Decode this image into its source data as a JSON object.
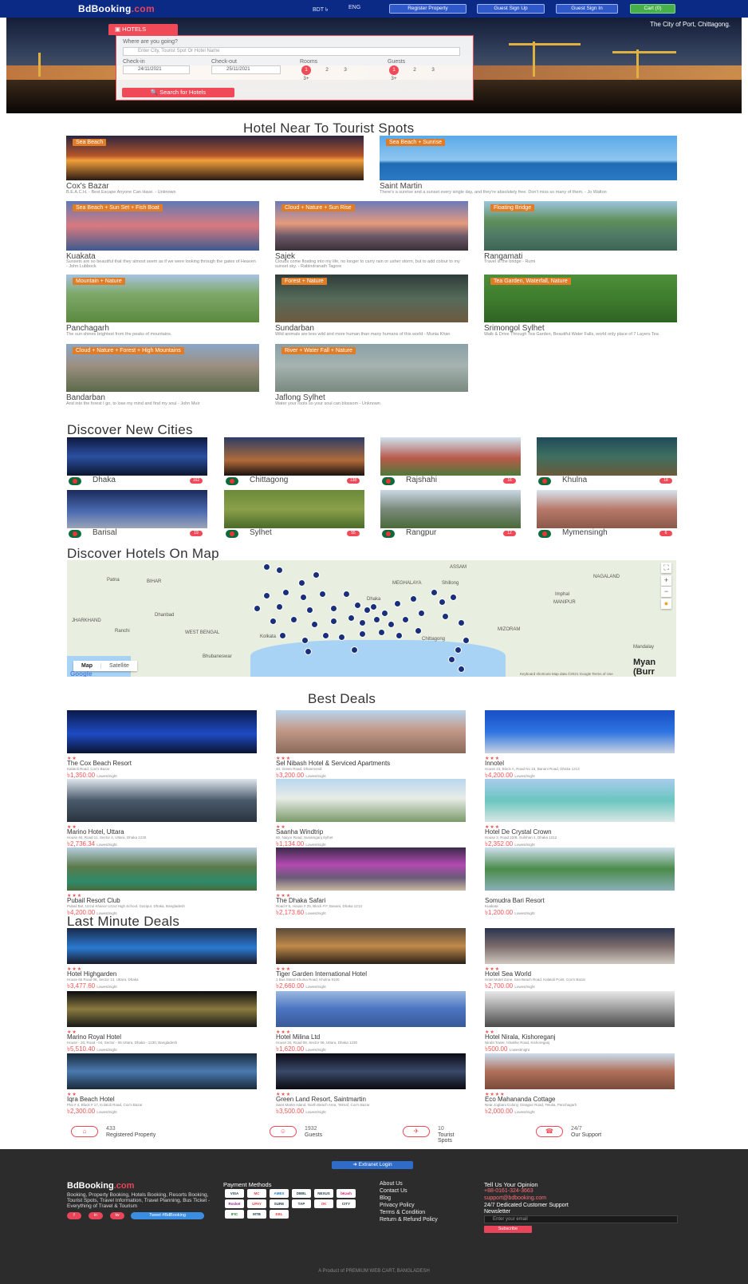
{
  "nav": {
    "brand": "BdBooking",
    "brand_suffix": ".com",
    "currency": "BDT ৳",
    "language": "ENG",
    "register_property": "Register Property",
    "guest_signup": "Guest Sign Up",
    "guest_signin": "Guest Sign In",
    "cart": "Cart (0)"
  },
  "hero": {
    "caption": "The City of Port, Chittagong.",
    "tab": "HOTELS",
    "where_label": "Where are you going?",
    "where_placeholder": "Enter City, Tourist Spot Or Hotel Name",
    "checkin_label": "Check-in",
    "checkin_value": "24/11/2021",
    "checkout_label": "Check-out",
    "checkout_value": "25/11/2021",
    "rooms_label": "Rooms",
    "guests_label": "Guests",
    "options": [
      "1",
      "2",
      "3"
    ],
    "more": "3+",
    "search_button": "Search for Hotels"
  },
  "spots": {
    "title": "Hotel Near To Tourist Spots",
    "items": [
      {
        "tag": "Sea Beach",
        "name": "Cox's Bazar",
        "quote": "B.E.A.C.H. - Best Escape Anyone Can Have. - Unknown"
      },
      {
        "tag": "Sea Beach + Sunrise",
        "name": "Saint Martin",
        "quote": "There's a sunrise and a sunset every single day, and they're absolutely free. Don't miss so many of them. - Jo Walton"
      },
      {
        "tag": "Sea Beach + Sun Set + Fish Boat",
        "name": "Kuakata",
        "quote": "Sunsets are so beautiful that they almost seem as if we were looking through the gates of Heaven - John Lubbock"
      },
      {
        "tag": "Cloud + Nature + Sun Rise",
        "name": "Sajek",
        "quote": "Clouds come floating into my life, no longer to carry rain or usher storm, but to add colour to my sunset sky. - Rabindranath Tagore"
      },
      {
        "tag": "Floating Bridge",
        "name": "Rangamati",
        "quote": "Travel is the bridge - Rumi"
      },
      {
        "tag": "Mountain + Nature",
        "name": "Panchagarh",
        "quote": "The sun shines brightest from the peaks of mountains."
      },
      {
        "tag": "Forest + Nature",
        "name": "Sundarban",
        "quote": "Wild animals are less wild and more human than many humans of this world - Munia Khan"
      },
      {
        "tag": "Tea Garden, Waterfall, Nature",
        "name": "Srimongol Sylhet",
        "quote": "Walk & Drive Through Tea Garden, Beautiful Water Falls, world only place of 7 Layers Tea"
      },
      {
        "tag": "Cloud + Nature + Forest + High Mountains",
        "name": "Bandarban",
        "quote": "And into the forest I go, to lose my mind and find my soul - John Muir"
      },
      {
        "tag": "River + Water Fall + Nature",
        "name": "Jaflong Sylhet",
        "quote": "Water your roots so your soul can blossom - Unknown"
      }
    ]
  },
  "cities": {
    "title": "Discover New Cities",
    "items": [
      {
        "name": "Dhaka",
        "count": "162"
      },
      {
        "name": "Chittagong",
        "count": "138"
      },
      {
        "name": "Rajshahi",
        "count": "16"
      },
      {
        "name": "Khulna",
        "count": "18"
      },
      {
        "name": "Barisal",
        "count": "19"
      },
      {
        "name": "Sylhet",
        "count": "55"
      },
      {
        "name": "Rangpur",
        "count": "12"
      },
      {
        "name": "Mymensingh",
        "count": "6"
      }
    ]
  },
  "map": {
    "title": "Discover Hotels On Map",
    "map_btn": "Map",
    "satellite_btn": "Satellite",
    "google": "Google",
    "attribution": "Keyboard shortcuts   Map data ©2021 Google   Terms of Use",
    "labels": [
      "Patna",
      "BIHAR",
      "JHARKHAND",
      "WEST BENGAL",
      "Kolkata",
      "MEGHALAYA",
      "NAGALAND",
      "MANIPUR",
      "MIZORAM",
      "Mandalay",
      "Myan (Burr",
      "Ranchi",
      "Dhanbad",
      "Bhubaneswar",
      "Dhaka",
      "Chittagong",
      "ASSAM",
      "Shillong",
      "Imphal"
    ]
  },
  "best": {
    "title": "Best Deals",
    "items": [
      {
        "stars": "★★",
        "name": "The Cox Beach Resort",
        "address": "Kalatoli Road, Cox's Bazar",
        "price": "৳1,350.00"
      },
      {
        "stars": "★★★",
        "name": "Sel Nibash Hotel & Serviced Apartments",
        "address": "40, Green Road, Dhanmondi",
        "price": "৳3,200.00"
      },
      {
        "stars": "★★★",
        "name": "Innotel",
        "address": "House 23, Block A, Road No 15, Banani Road, Dhaka 1213",
        "price": "৳4,200.00"
      },
      {
        "stars": "★★",
        "name": "Marino Hotel, Uttara",
        "address": "House 40, Road 11, Sector 4, Uttara, Dhaka 1230",
        "price": "৳2,736.34"
      },
      {
        "stars": "★★",
        "name": "Saanha Windtrip",
        "address": "60, Naiyor Road, Sunamganj Sylhet",
        "price": "৳1,134.00"
      },
      {
        "stars": "★★★",
        "name": "Hotel De Crystal Crown",
        "address": "House 3, Road 22/B, Gulshan 1, Dhaka 1212",
        "price": "৳2,352.00"
      },
      {
        "stars": "★★★",
        "name": "Pubail Resort Club",
        "address": "Pubail Bot, Uzzul Khanor Uzzul High School, Gazipur, Dhaka, Bangladesh",
        "price": "৳4,200.00"
      },
      {
        "stars": "★★★",
        "name": "The Dhaka Safari",
        "address": "Road # 6, House # 25, Block # F, Banani, Dhaka 1213",
        "price": "৳2,173.60"
      },
      {
        "stars": "",
        "name": "Somudra Bari Resort",
        "address": "Kuakata",
        "price": "৳1,200.00"
      }
    ]
  },
  "last": {
    "title": "Last Minute Deals",
    "items": [
      {
        "stars": "★★★",
        "name": "Hotel Highgarden",
        "address": "House 65 Road 08, Sector 13, Uttara, Dhaka",
        "price": "৳3,477.60"
      },
      {
        "stars": "★★★",
        "name": "Tiger Garden International Hotel",
        "address": "1 Bus Stand Khulna Road, Khulna 9100",
        "price": "৳2,660.00"
      },
      {
        "stars": "★★★",
        "name": "Hotel Sea World",
        "address": "Hotel Motel Zone, Sea Beach Road, Kalatoli Point, Cox's Bazar",
        "price": "৳2,700.00"
      },
      {
        "stars": "★★",
        "name": "Marino Royal Hotel",
        "address": "House - 20, Road - 04, Sector - 06 Uttara, Dhaka - 1230, Bangladesh",
        "price": "৳5,510.40"
      },
      {
        "stars": "★★★",
        "name": "Hotel Milina Ltd",
        "address": "House 34, Road 08, Sector 06, Uttara, Dhaka 1230",
        "price": "৳1,620.00"
      },
      {
        "stars": "★★",
        "name": "Hotel Nirala, Kishoreganj",
        "address": "Nirala Tower, Ishakhe Road, Kishoreganj",
        "price": "৳500.00"
      },
      {
        "stars": "★★",
        "name": "Iqra Beach Hotel",
        "address": "Plot # 4, Block # 17, Kolatoli Road, Cox's Bazar",
        "price": "৳2,300.00"
      },
      {
        "stars": "★★★",
        "name": "Green Land Resort, Saintmartin",
        "address": "Saint Martin Island, North Beach Area, Teknaf, Cox's Bazar",
        "price": "৳3,500.00"
      },
      {
        "stars": "★★★★",
        "name": "Eco Mahananda Cottage",
        "address": "Near Jogbani Colony, Dinajpur Road, Tetulia, Panchagarh",
        "price": "৳2,000.00"
      }
    ]
  },
  "per_night": "Lowest/night",
  "stats": [
    {
      "icon": "home-icon",
      "number": "433",
      "label": "Registered Property"
    },
    {
      "icon": "users-icon",
      "number": "1932",
      "label": "Guests"
    },
    {
      "icon": "plane-icon",
      "number": "10",
      "label": "Tourist Spots"
    },
    {
      "icon": "phone-icon",
      "number": "24/7",
      "label": "Our Support"
    }
  ],
  "footer": {
    "extranet": "Extranet Login",
    "brand": "BdBooking",
    "brand_suffix": ".com",
    "desc": "Booking, Property Booking, Hotels Booking, Resorts Booking, Tourist Spots, Travel Information, Travel Planning, Bus Ticket - Everything of Travel & Tourism",
    "social": [
      "f",
      "in",
      "tw"
    ],
    "tweet": "Tweet #BdBooking",
    "payment_title": "Payment Methods",
    "payments": [
      "VISA",
      "MC",
      "AMEX",
      "DBBL",
      "NEXUS",
      "bKash",
      "Rocket",
      "UPAY",
      "SURE",
      "TAP",
      "OK",
      "CITY",
      "IFIC",
      "MTB",
      "EBL"
    ],
    "links": [
      "About Us",
      "Contact Us",
      "Blog",
      "Privacy Policy",
      "Terms & Condition",
      "Return & Refund Policy"
    ],
    "opinion_title": "Tell Us Your Opinion",
    "phone": "+88-0161-324-3663",
    "email": "support@bdbooking.com",
    "support": "24/7 Dedicated Customer Support",
    "newsletter": "Newsletter",
    "nl_placeholder": "Enter your email",
    "subscribe": "Subscribe",
    "credit": "A Product of PREMIUM WEB CART, BANGLADESH"
  },
  "colors": {
    "nav": "#0b2a86",
    "accent": "#f04a58",
    "tag": "#e07b26",
    "footer": "#2c2c2c"
  }
}
